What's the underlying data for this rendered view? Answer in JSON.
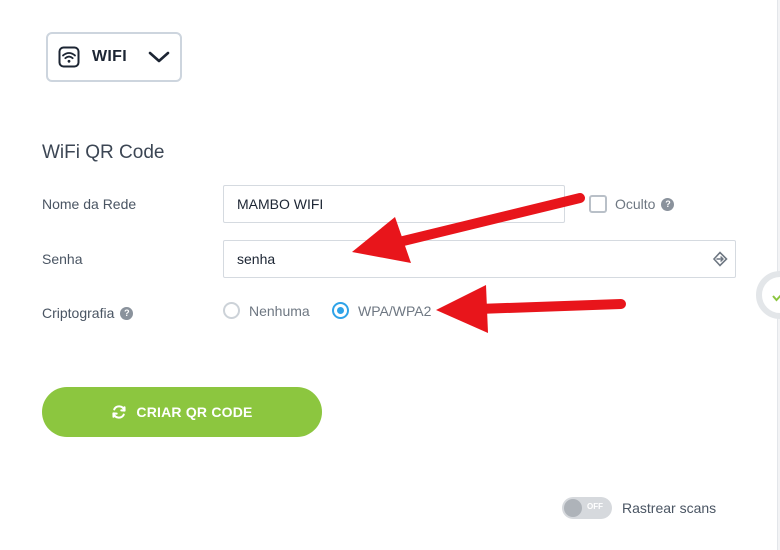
{
  "qr_type": {
    "label": "WIFI",
    "icon": "wifi-icon"
  },
  "form": {
    "title": "WiFi QR Code",
    "network_label": "Nome da Rede",
    "network_value": "MAMBO WIFI",
    "hidden_label": "Oculto",
    "hidden_checked": false,
    "password_label": "Senha",
    "password_value": "senha",
    "encryption_label": "Criptografia",
    "encryption_options": [
      "Nenhuma",
      "WPA/WPA2"
    ],
    "encryption_selected": "WPA/WPA2"
  },
  "create_button": {
    "label": "CRIAR QR CODE"
  },
  "track_scans": {
    "toggle_text": "OFF",
    "label": "Rastrear scans",
    "enabled": false
  },
  "colors": {
    "accent_green": "#8cc63f",
    "radio_blue": "#2fa3e8",
    "annotation_red": "#e8151b"
  }
}
